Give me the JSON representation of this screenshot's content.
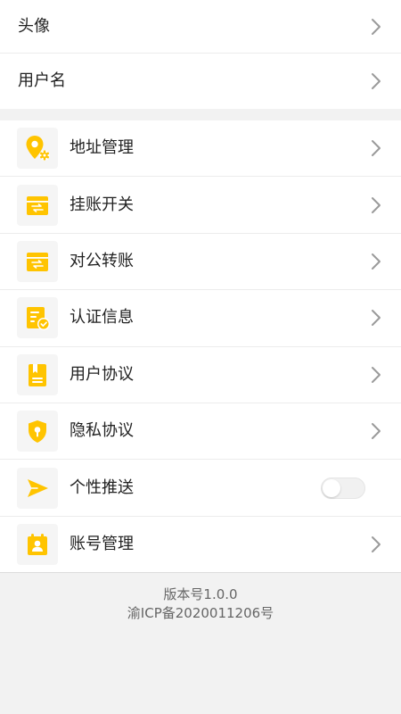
{
  "profile": {
    "items": [
      {
        "label": "头像"
      },
      {
        "label": "用户名"
      }
    ]
  },
  "menu": {
    "items": [
      {
        "label": "地址管理",
        "icon": "location-settings-icon"
      },
      {
        "label": "挂账开关",
        "icon": "credit-card-icon"
      },
      {
        "label": "对公转账",
        "icon": "transfer-card-icon"
      },
      {
        "label": "认证信息",
        "icon": "verified-document-icon"
      },
      {
        "label": "用户协议",
        "icon": "user-agreement-icon"
      },
      {
        "label": "隐私协议",
        "icon": "privacy-shield-icon"
      },
      {
        "label": "个性推送",
        "icon": "send-icon",
        "toggle": false
      },
      {
        "label": "账号管理",
        "icon": "account-icon"
      }
    ]
  },
  "footer": {
    "version": "版本号1.0.0",
    "icp": "渝ICP备2020011206号"
  },
  "colors": {
    "accent": "#FFC400",
    "background": "#F2F2F2"
  }
}
